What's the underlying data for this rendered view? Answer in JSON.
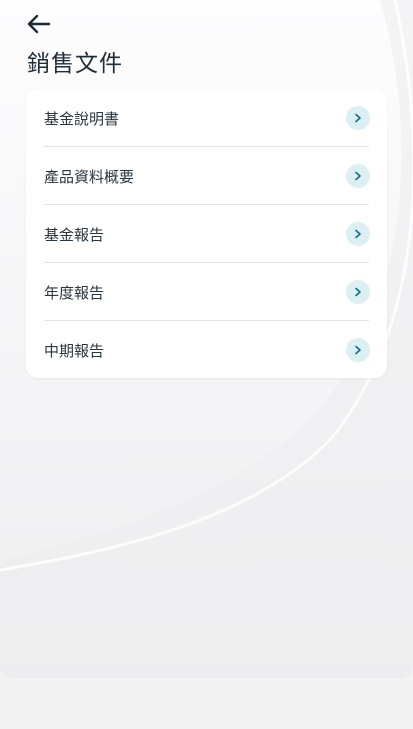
{
  "header": {
    "back_icon": "arrow-left-icon",
    "title": "銷售文件"
  },
  "documents": {
    "items": [
      {
        "label": "基金說明書",
        "icon": "chevron-right-icon"
      },
      {
        "label": "產品資料概要",
        "icon": "chevron-right-icon"
      },
      {
        "label": "基金報告",
        "icon": "chevron-right-icon"
      },
      {
        "label": "年度報告",
        "icon": "chevron-right-icon"
      },
      {
        "label": "中期報告",
        "icon": "chevron-right-icon"
      }
    ]
  },
  "colors": {
    "accent_chevron_bg": "#dcf0f3",
    "accent_chevron": "#0f6f86",
    "text": "#2a3640"
  }
}
